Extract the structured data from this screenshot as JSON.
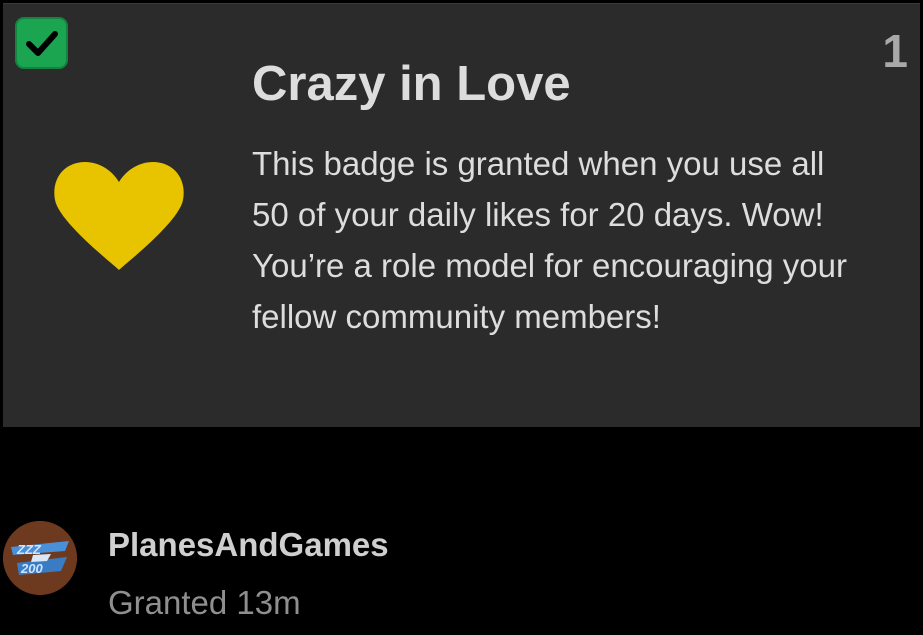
{
  "badge": {
    "title": "Crazy in Love",
    "description": "This badge is granted when you use all 50 of your daily likes for 20 days. Wow! You’re a role model for encouraging your fellow community members!",
    "count": "1",
    "granted_icon": "checkmark-icon",
    "badge_icon": "heart-icon",
    "heart_color": "#e8c300",
    "check_color": "#1ca551"
  },
  "grant": {
    "username": "PlanesAndGames",
    "granted_text": "Granted 13m",
    "avatar_icon": "plane-logo-avatar",
    "avatar_text": "ZZZ 200"
  }
}
